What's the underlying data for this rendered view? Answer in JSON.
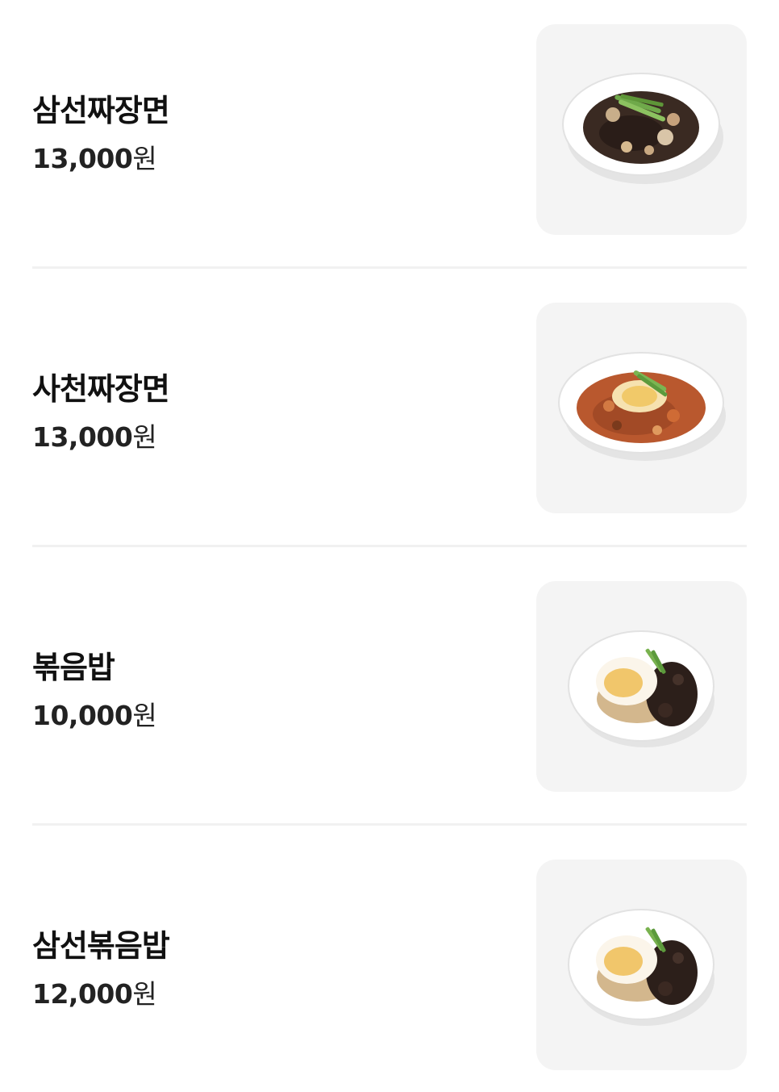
{
  "menu": {
    "currency_suffix": "원",
    "items": [
      {
        "name": "삼선짜장면",
        "price": "13,000",
        "photo_icon": "jjajangmyeon-dish-icon"
      },
      {
        "name": "사천짜장면",
        "price": "13,000",
        "photo_icon": "sacheon-jjajangmyeon-dish-icon"
      },
      {
        "name": "볶음밥",
        "price": "10,000",
        "photo_icon": "fried-rice-dish-icon"
      },
      {
        "name": "삼선볶음밥",
        "price": "12,000",
        "photo_icon": "seafood-fried-rice-dish-icon"
      }
    ]
  },
  "colors": {
    "text": "#111111",
    "thumbnail_bg": "#f4f4f4",
    "divider": "#f1f1f1"
  }
}
